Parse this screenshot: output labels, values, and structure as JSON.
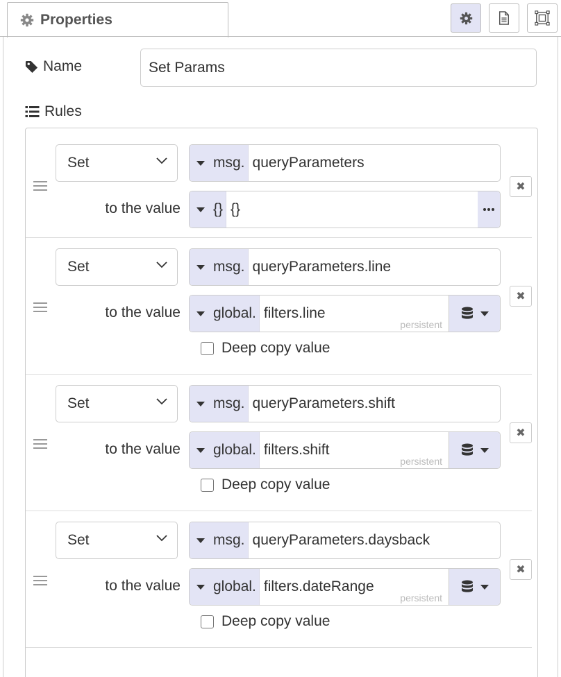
{
  "tab": {
    "label": "Properties",
    "icon": "gear-icon"
  },
  "toolbar": {
    "buttons": [
      "gear-icon",
      "document-icon",
      "frame-icon"
    ]
  },
  "name_field": {
    "label": "Name",
    "value": "Set Params"
  },
  "rules_label": "Rules",
  "rules": [
    {
      "action": "Set",
      "target_type": "msg.",
      "target": "queryParameters",
      "to_label": "to the value",
      "value_type": "{}",
      "value": "{}",
      "persistent": "",
      "deep_copy": ""
    },
    {
      "action": "Set",
      "target_type": "msg.",
      "target": "queryParameters.line",
      "to_label": "to the value",
      "value_type": "global.",
      "value": "filters.line",
      "persistent": "persistent",
      "deep_copy": "Deep copy value"
    },
    {
      "action": "Set",
      "target_type": "msg.",
      "target": "queryParameters.shift",
      "to_label": "to the value",
      "value_type": "global.",
      "value": "filters.shift",
      "persistent": "persistent",
      "deep_copy": "Deep copy value"
    },
    {
      "action": "Set",
      "target_type": "msg.",
      "target": "queryParameters.daysback",
      "to_label": "to the value",
      "value_type": "global.",
      "value": "filters.dateRange",
      "persistent": "persistent",
      "deep_copy": "Deep copy value"
    }
  ],
  "delete_glyph": "✖",
  "colors": {
    "type_bg": "#e3e4f5",
    "border": "#cccccc",
    "text": "#333333",
    "muted": "#bbbbbb"
  }
}
